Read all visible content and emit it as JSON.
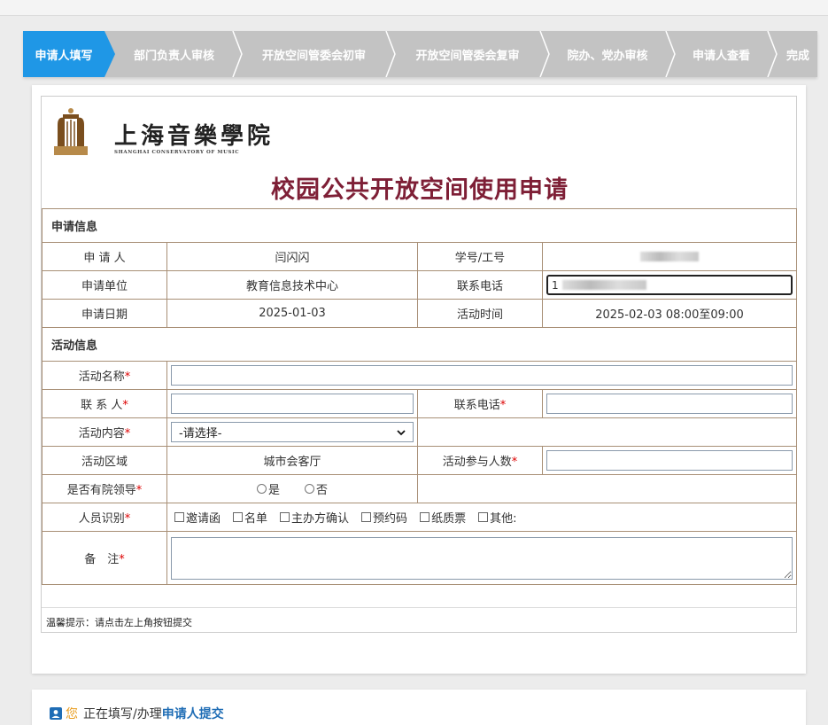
{
  "steps": [
    "申请人填写",
    "部门负责人审核",
    "开放空间管委会初审",
    "开放空间管委会复审",
    "院办、党办审核",
    "申请人查看",
    "完成"
  ],
  "logo": {
    "main": "上海音樂學院",
    "sub": "SHANGHAI CONSERVATORY OF MUSIC"
  },
  "title": "校园公共开放空间使用申请",
  "sections": {
    "apply_info": "申请信息",
    "activity_info": "活动信息"
  },
  "apply": {
    "applicant_label": "申 请 人",
    "applicant": "闫闪闪",
    "id_label": "学号/工号",
    "unit_label": "申请单位",
    "unit": "教育信息技术中心",
    "phone_label": "联系电话",
    "phone_prefix": "1",
    "date_label": "申请日期",
    "date": "2025-01-03",
    "time_label": "活动时间",
    "time": "2025-02-03  08:00至09:00"
  },
  "activity": {
    "name_label": "活动名称",
    "contact_label": "联 系 人",
    "contact_phone_label": "联系电话",
    "content_label": "活动内容",
    "content_selected": "-请选择-",
    "area_label": "活动区域",
    "area": "城市会客厅",
    "count_label": "活动参与人数",
    "leader_label": "是否有院领导",
    "yes": "是",
    "no": "否",
    "ident_label": "人员识别",
    "ident_options": [
      "邀请函",
      "名单",
      "主办方确认",
      "预约码",
      "纸质票",
      "其他:"
    ],
    "remark_label": "备　注",
    "required_mark": "*"
  },
  "tip": "温馨提示：请点击左上角按钮提交",
  "status": {
    "you": "您",
    "text": "正在填写/办理",
    "stage": "申请人提交"
  },
  "colors": {
    "accent": "#1f97e6",
    "title": "#7e1f36",
    "border": "#a88f76"
  }
}
